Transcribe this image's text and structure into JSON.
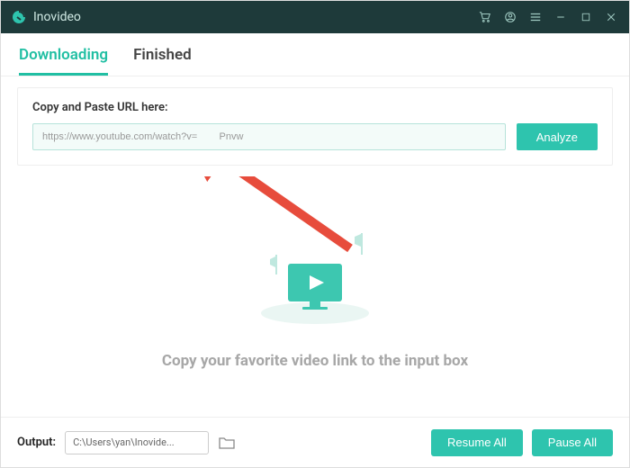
{
  "app": {
    "name": "Inovideo"
  },
  "tabs": {
    "downloading": "Downloading",
    "finished": "Finished"
  },
  "url_card": {
    "label": "Copy and Paste URL here:",
    "input_value": "https://www.youtube.com/watch?v=        Pnvw",
    "analyze_label": "Analyze"
  },
  "empty": {
    "message": "Copy your favorite video link to the input box"
  },
  "footer": {
    "output_label": "Output:",
    "output_path": "C:\\Users\\yan\\Inovide...",
    "resume_label": "Resume All",
    "pause_label": "Pause All"
  },
  "colors": {
    "accent": "#2ec4ae",
    "titlebar": "#1e3a3a",
    "arrow": "#e74c3c"
  }
}
